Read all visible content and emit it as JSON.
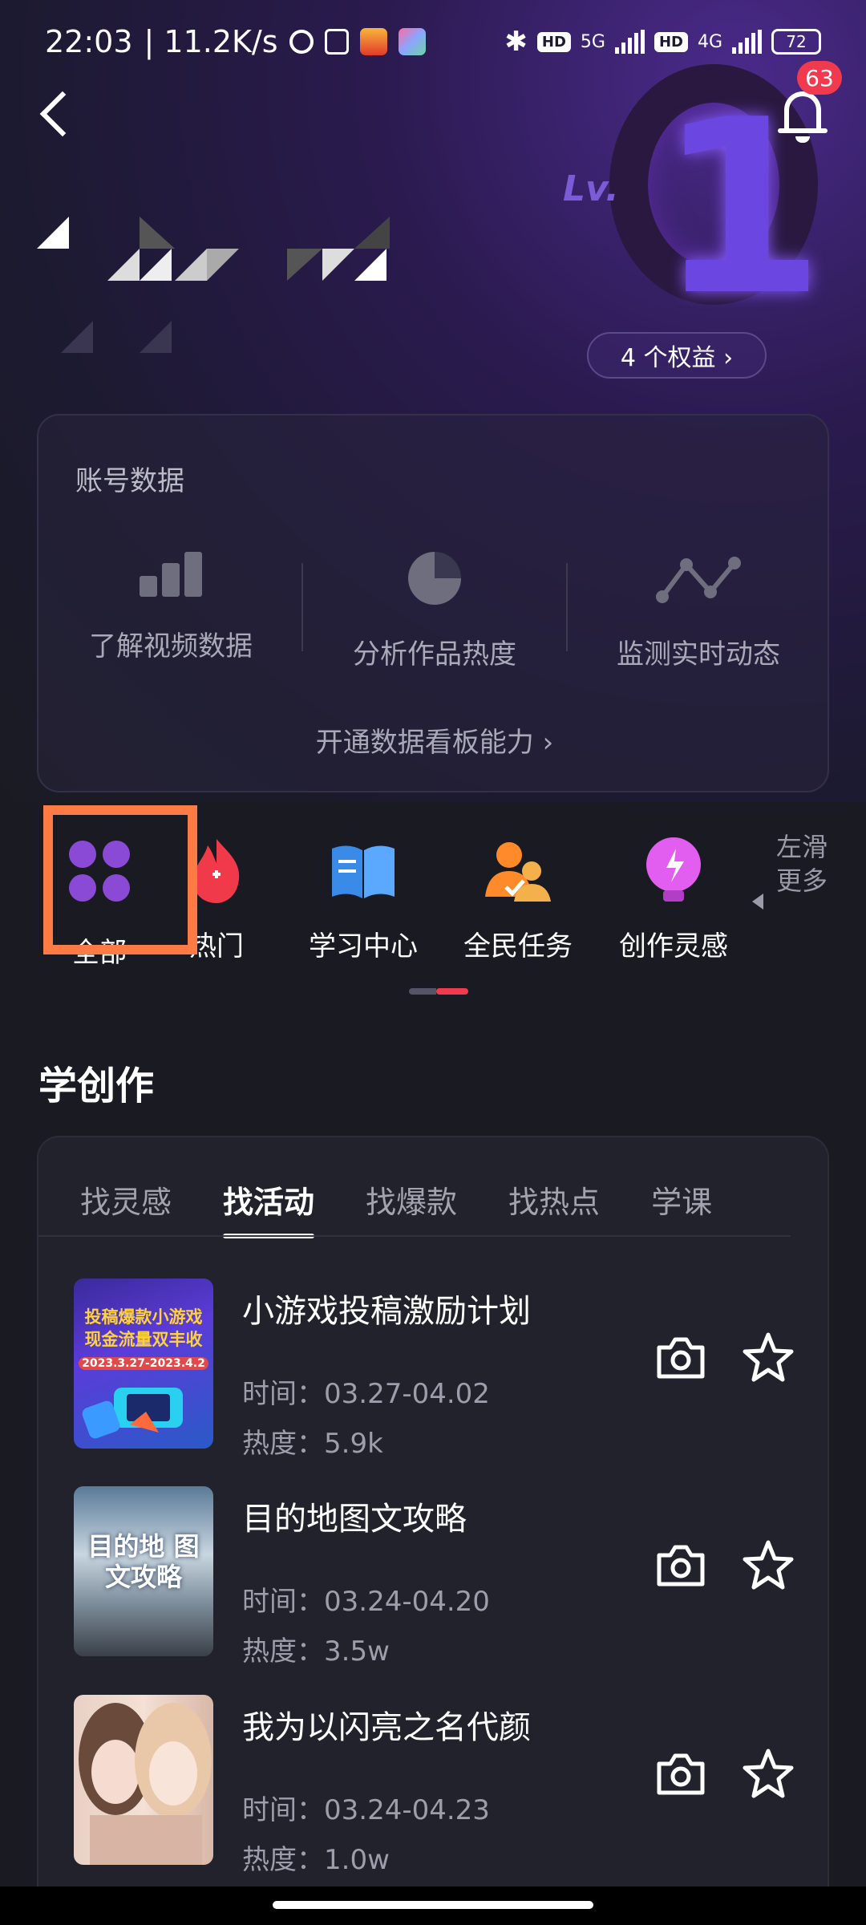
{
  "status_bar": {
    "time": "22:03",
    "speed": "| 11.2K/s",
    "battery": "72",
    "net1": "5G",
    "net2": "4G",
    "hd": "HD"
  },
  "header": {
    "notification_count": "63",
    "level_prefix": "Lv.",
    "level_value": "1",
    "benefits_label": "4 个权益 ›"
  },
  "account_data": {
    "title": "账号数据",
    "metrics": [
      {
        "label": "了解视频数据",
        "icon": "bar-chart-icon"
      },
      {
        "label": "分析作品热度",
        "icon": "pie-chart-icon"
      },
      {
        "label": "监测实时动态",
        "icon": "line-chart-icon"
      }
    ],
    "open_link": "开通数据看板能力 ›"
  },
  "shortcuts": {
    "items": [
      {
        "label": "全部",
        "icon": "grid-icon"
      },
      {
        "label": "热门",
        "icon": "flame-icon"
      },
      {
        "label": "学习中心",
        "icon": "book-icon"
      },
      {
        "label": "全民任务",
        "icon": "users-task-icon"
      },
      {
        "label": "创作灵感",
        "icon": "lightbulb-icon"
      }
    ],
    "swipe_hint": "左滑更多"
  },
  "learn": {
    "section_title": "学创作",
    "tabs": [
      "找灵感",
      "找活动",
      "找爆款",
      "找热点",
      "学课"
    ],
    "active_tab": "找活动",
    "items": [
      {
        "title": "小游戏投稿激励计划",
        "time": "时间：03.27-04.02",
        "heat": "热度：5.9k",
        "thumb_text": "投稿爆款小游戏 现金流量双丰收",
        "thumb_date": "2023.3.27-2023.4.2"
      },
      {
        "title": "目的地图文攻略",
        "time": "时间：03.24-04.20",
        "heat": "热度：3.5w",
        "thumb_text": "目的地 图文攻略"
      },
      {
        "title": "我为以闪亮之名代颜",
        "time": "时间：03.24-04.23",
        "heat": "热度：1.0w"
      }
    ]
  },
  "colors": {
    "accent_red": "#f23a4f",
    "highlight_orange": "#ff7b45",
    "purple": "#8b4ad6"
  }
}
